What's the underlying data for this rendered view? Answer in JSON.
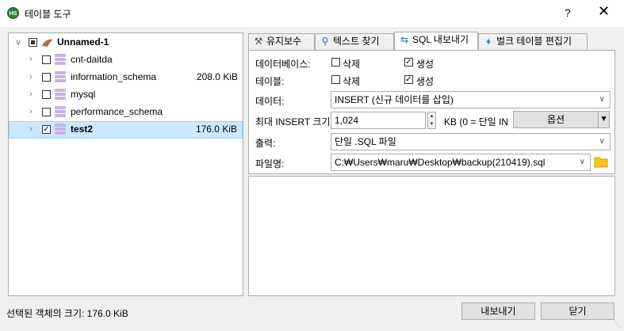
{
  "window": {
    "title": "테이블 도구",
    "help": "?",
    "close": "✕",
    "app_icon_text": "HS"
  },
  "tree": {
    "root": {
      "label": "Unnamed-1"
    },
    "items": [
      {
        "label": "cnt-daitda",
        "size": ""
      },
      {
        "label": "information_schema",
        "size": "208.0 KiB"
      },
      {
        "label": "mysql",
        "size": ""
      },
      {
        "label": "performance_schema",
        "size": ""
      },
      {
        "label": "test2",
        "size": "176.0 KiB"
      }
    ]
  },
  "tabs": [
    {
      "label": "유지보수",
      "icon": "wrench-icon"
    },
    {
      "label": "텍스트 찾기",
      "icon": "magnifier-icon"
    },
    {
      "label": "SQL 내보내기",
      "icon": "export-arrows-icon"
    },
    {
      "label": "벌크 테이블 편집기",
      "icon": "table-stack-icon"
    }
  ],
  "form": {
    "database_label": "데이터베이스:",
    "table_label": "테이블:",
    "drop_label": "삭제",
    "create_label": "생성",
    "data_label": "데이터:",
    "data_value": "INSERT (신규 데이터를 삽입)",
    "max_insert_label": "최대 INSERT 크기:",
    "max_insert_value": "1,024",
    "kb_hint": "KB (0 = 단일 IN",
    "options_button": "옵션",
    "output_label": "출력:",
    "output_value": "단일 .SQL 파일",
    "filename_label": "파일명:",
    "filename_value": "C:₩Users₩maru₩Desktop₩backup(210419).sql"
  },
  "status": {
    "text": "선택된 객체의 크기: 176.0 KiB"
  },
  "buttons": {
    "export": "내보내기",
    "close": "닫기"
  },
  "colors": {
    "selection": "#cce8ff",
    "db_icon": "#c7b3e3",
    "folder": "#f5c518"
  }
}
